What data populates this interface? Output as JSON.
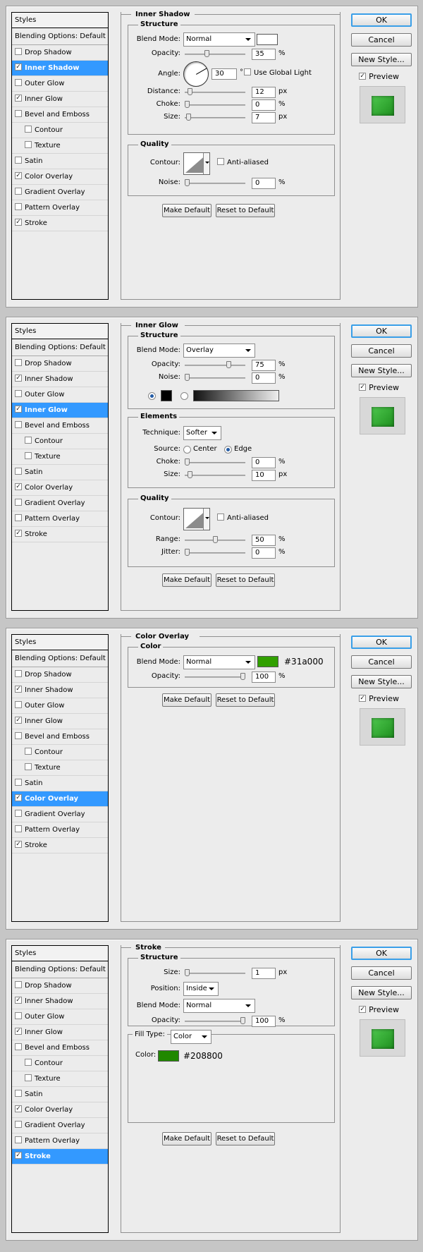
{
  "sidebar": {
    "header": "Styles",
    "blending": "Blending Options: Default",
    "items": [
      "Drop Shadow",
      "Inner Shadow",
      "Outer Glow",
      "Inner Glow",
      "Bevel and Emboss",
      "Contour",
      "Texture",
      "Satin",
      "Color Overlay",
      "Gradient Overlay",
      "Pattern Overlay",
      "Stroke"
    ]
  },
  "check_glyph": "✓",
  "buttons": {
    "ok": "OK",
    "cancel": "Cancel",
    "new_style": "New Style...",
    "preview": "Preview",
    "make_default": "Make Default",
    "reset_default": "Reset to Default"
  },
  "labels": {
    "structure": "Structure",
    "quality": "Quality",
    "elements": "Elements",
    "color": "Color",
    "blend_mode": "Blend Mode:",
    "opacity": "Opacity:",
    "angle": "Angle:",
    "distance": "Distance:",
    "choke": "Choke:",
    "size": "Size:",
    "contour": "Contour:",
    "noise": "Noise:",
    "anti_aliased": "Anti-aliased",
    "use_global_light": "Use Global Light",
    "technique": "Technique:",
    "source": "Source:",
    "center": "Center",
    "edge": "Edge",
    "range": "Range:",
    "jitter": "Jitter:",
    "position": "Position:",
    "fill_type": "Fill Type:",
    "color_lbl": "Color:",
    "percent": "%",
    "px": "px",
    "degree": "°"
  },
  "inner_shadow": {
    "title": "Inner Shadow",
    "blend": "Normal",
    "opacity": "35",
    "angle": "30",
    "distance": "12",
    "choke": "0",
    "size": "7",
    "noise": "0",
    "opacity_level": 0.35,
    "distance_level": 0.05,
    "choke_level": 0,
    "size_level": 0.03,
    "noise_level": 0
  },
  "inner_glow": {
    "title": "Inner Glow",
    "blend": "Overlay",
    "opacity": "75",
    "noise": "0",
    "technique": "Softer",
    "choke": "0",
    "size": "10",
    "range": "50",
    "jitter": "0",
    "opacity_level": 0.75,
    "range_level": 0.5
  },
  "color_overlay": {
    "title": "Color Overlay",
    "blend": "Normal",
    "color": "#31a000",
    "opacity": "100"
  },
  "stroke": {
    "title": "Stroke",
    "size": "1",
    "position": "Inside",
    "blend": "Normal",
    "opacity": "100",
    "fill_type": "Color",
    "color": "#208800"
  },
  "selected": [
    "Inner Shadow",
    "Inner Glow",
    "Color Overlay",
    "Stroke"
  ]
}
